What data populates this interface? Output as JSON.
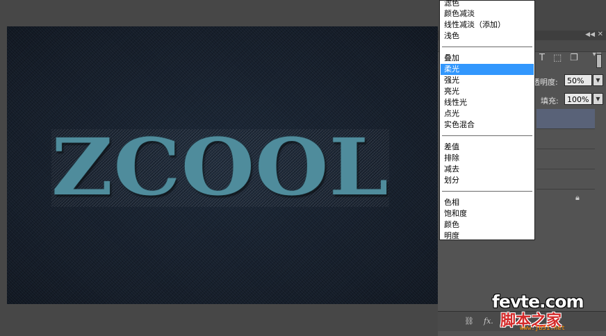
{
  "canvas": {
    "text": "ZCOOL",
    "text_color": "#4f8c9c",
    "background_color": "#18212e"
  },
  "layers_panel": {
    "opacity_label": "透明度:",
    "opacity_value": "50%",
    "fill_label": "填充:",
    "fill_value": "100%",
    "icons": [
      "collapse-icon",
      "close-icon",
      "panel-menu-icon",
      "text-layer-icon",
      "transform-icon",
      "document-icon",
      "lock-icon",
      "link-icon",
      "fx-icon",
      "mask-icon"
    ]
  },
  "blend_menu": {
    "groups": [
      [
        "滤色",
        "颜色减淡",
        "线性减淡（添加）",
        "浅色"
      ],
      [
        "叠加",
        "柔光",
        "强光",
        "亮光",
        "线性光",
        "点光",
        "实色混合"
      ],
      [
        "差值",
        "排除",
        "减去",
        "划分"
      ],
      [
        "色相",
        "饱和度",
        "颜色",
        "明度"
      ]
    ],
    "selected": "柔光",
    "highlight_color": "#3297fd"
  },
  "watermark": {
    "main": "fevte.com",
    "sub": "脚本之家",
    "url": "www.jb51.net"
  }
}
